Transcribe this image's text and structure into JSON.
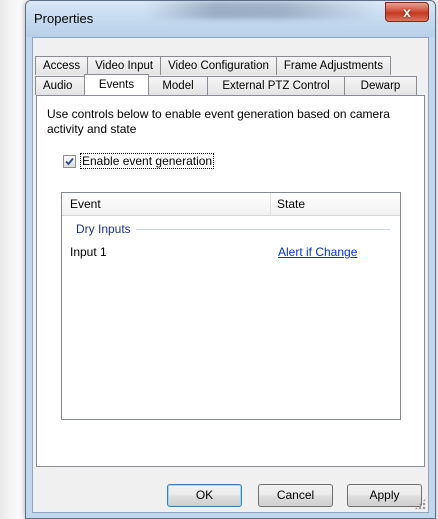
{
  "window": {
    "title": "Properties",
    "close_glyph": "x"
  },
  "tabs": {
    "row_top": [
      "Access",
      "Video Input",
      "Video Configuration",
      "Frame Adjustments"
    ],
    "row_bottom": [
      "Audio",
      "Events",
      "Model",
      "External PTZ Control",
      "Dewarp"
    ],
    "active": "Events"
  },
  "events_tab": {
    "description": "Use controls below to enable event generation based on camera activity and state",
    "enable_checkbox": {
      "label": "Enable event generation",
      "checked": true
    },
    "list": {
      "columns": [
        "Event",
        "State"
      ],
      "groups": [
        {
          "name": "Dry Inputs",
          "items": [
            {
              "event": "Input 1",
              "state": "Alert if Change"
            }
          ]
        }
      ]
    }
  },
  "buttons": {
    "ok": "OK",
    "cancel": "Cancel",
    "apply": "Apply"
  },
  "colors": {
    "link": "#0033cc",
    "group_header": "#1e3287",
    "window_frame": "#c2d7ee"
  },
  "icons": [
    "close-icon",
    "checkmark-icon",
    "resize-grip-icon"
  ]
}
